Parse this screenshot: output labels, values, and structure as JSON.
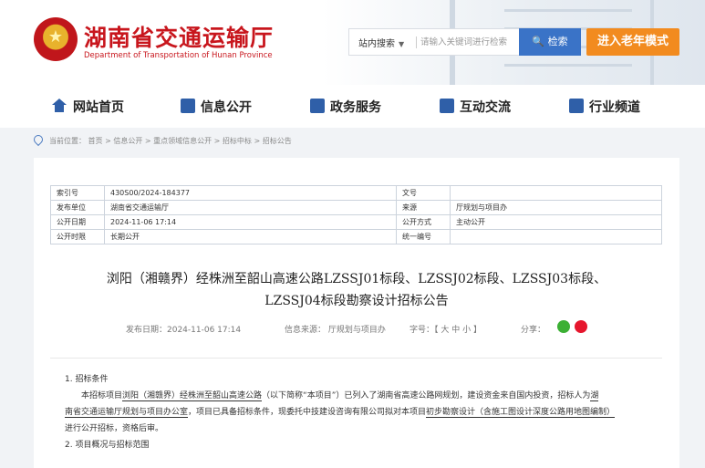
{
  "header": {
    "title": "湖南省交通运输厅",
    "subtitle": "Department of Transportation of Hunan Province",
    "emblem_glyph": "★",
    "search": {
      "scope": "站内搜索",
      "placeholder": "请输入关键词进行检索",
      "button": "检索"
    },
    "elder_mode": "进入老年模式"
  },
  "nav": [
    {
      "label": "网站首页",
      "icon": "home-icon"
    },
    {
      "label": "信息公开",
      "icon": "document-icon"
    },
    {
      "label": "政务服务",
      "icon": "service-icon"
    },
    {
      "label": "互动交流",
      "icon": "chat-icon"
    },
    {
      "label": "行业频道",
      "icon": "channel-icon"
    }
  ],
  "breadcrumb": "当前位置： 首页 > 信息公开 > 重点领域信息公开 > 招标中标 > 招标公告",
  "meta": {
    "index_no_label": "索引号",
    "index_no": "430S00/2024-184377",
    "doc_no_label": "文号",
    "doc_no": "",
    "publisher_label": "发布单位",
    "publisher": "湖南省交通运输厅",
    "source_label": "来源",
    "source": "厅规划与项目办",
    "date_label": "公开日期",
    "date": "2024-11-06 17:14",
    "mode_label": "公开方式",
    "mode": "主动公开",
    "period_label": "公开时限",
    "period": "长期公开",
    "code_label": "统一编号",
    "code": ""
  },
  "article": {
    "title_line1": "浏阳（湘赣界）经株洲至韶山高速公路LZSSJ01标段、LZSSJ02标段、LZSSJ03标段、",
    "title_line2": "LZSSJ04标段勘察设计招标公告",
    "pub_time": "发布日期：2024-11-06 17:14",
    "pub_source": "信息来源： 厅规划与项目办",
    "font_size": "字号：【 大 中 小 】",
    "share": "分享：",
    "s1_heading": "1. 招标条件",
    "p1_a": "本招标项目",
    "p1_proj": "浏阳（湘赣界）经株洲至韶山高速公路",
    "p1_b": "（以下简称“本项目”）已列入了湖南省高速公路网规划，建设资金来自国内投资，招标人为",
    "p1_c1": "湖",
    "p1_c2": "南省交通运输厅规划与项目办公室",
    "p1_d": "，项目已具备招标条件，现委托中技建设咨询有限公司拟对本项目",
    "p1_scope": "初步勘察设计（含施工图设计深度公路用地图编制）",
    "p1_e": "进行公开招标，资格后审。",
    "s2_heading": "2. 项目概况与招标范围"
  }
}
